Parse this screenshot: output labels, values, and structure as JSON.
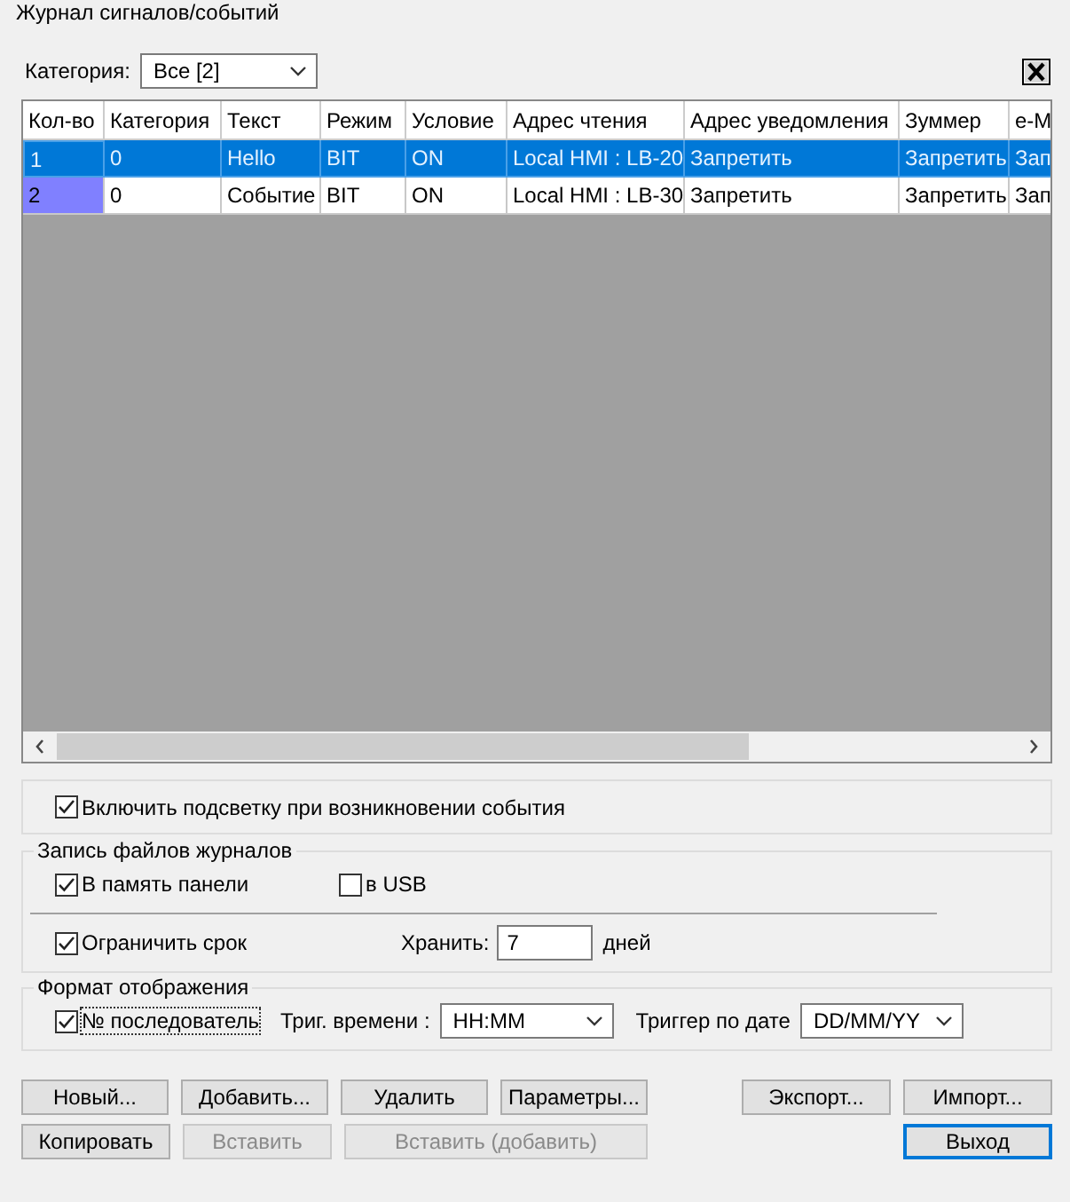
{
  "window": {
    "title": "Журнал сигналов/событий"
  },
  "category": {
    "label": "Категория:",
    "value": "Все [2]"
  },
  "table": {
    "columns": [
      "Кол-во",
      "Категория",
      "Текст",
      "Режим",
      "Условие",
      "Адрес чтения",
      "Адрес уведомления",
      "Зуммер",
      "e-M"
    ],
    "rows": [
      {
        "selected": true,
        "cells": [
          "1",
          "0",
          "Hello",
          "BIT",
          "ON",
          "Local HMI : LB-20",
          "Запретить",
          "Запретить",
          "Зап"
        ]
      },
      {
        "selected": false,
        "color": "#8080ff",
        "cells": [
          "2",
          "0",
          "Событие",
          "BIT",
          "ON",
          "Local HMI : LB-30",
          "Запретить",
          "Запретить",
          "Зап"
        ]
      }
    ]
  },
  "highlight": {
    "label": "Включить подсветку при возникновении события",
    "checked": true
  },
  "log_files": {
    "title": "Запись файлов журналов",
    "panel_memory": {
      "label": "В память панели",
      "checked": true
    },
    "usb": {
      "label": "в USB",
      "checked": false
    },
    "limit": {
      "label": "Ограничить срок",
      "checked": true
    },
    "keep": {
      "label": "Хранить:",
      "value": "7",
      "unit": "дней"
    }
  },
  "display_format": {
    "title": "Формат отображения",
    "sequence": {
      "label": "№ последователь",
      "checked": true
    },
    "time": {
      "label": "Триг. времени :",
      "value": "HH:MM"
    },
    "date": {
      "label": "Триггер по дате",
      "value": "DD/MM/YY"
    }
  },
  "button_rows": [
    {
      "left": [
        {
          "label": "Новый...",
          "disabled": false,
          "default": false
        },
        {
          "label": "Добавить...",
          "disabled": false,
          "default": false
        },
        {
          "label": "Удалить",
          "disabled": false,
          "default": false
        },
        {
          "label": "Параметры...",
          "disabled": false,
          "default": false
        }
      ],
      "right": [
        {
          "label": "Экспорт...",
          "disabled": false,
          "default": false
        },
        {
          "label": "Импорт...",
          "disabled": false,
          "default": false
        }
      ]
    },
    {
      "left": [
        {
          "label": "Копировать",
          "disabled": false,
          "default": false
        },
        {
          "label": "Вставить",
          "disabled": true,
          "default": false
        },
        {
          "label": "Вставить (добавить)",
          "disabled": true,
          "default": false
        }
      ],
      "right": [
        {
          "label": "Выход",
          "disabled": false,
          "default": true
        }
      ]
    }
  ]
}
